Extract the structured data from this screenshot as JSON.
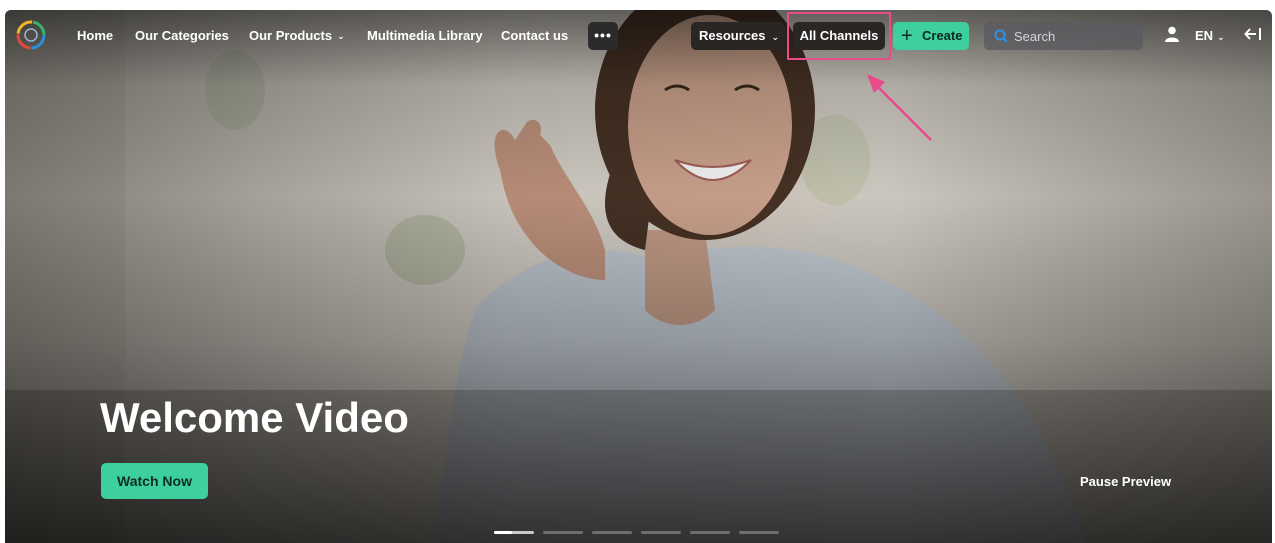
{
  "nav": {
    "links": [
      {
        "label": "Home"
      },
      {
        "label": "Our Categories"
      },
      {
        "label": "Our Products",
        "has_dropdown": true
      },
      {
        "label": "Multimedia Library"
      },
      {
        "label": "Contact us"
      }
    ],
    "more_label": "•••",
    "resources_label": "Resources",
    "all_channels_label": "All Channels",
    "create_label": "Create",
    "search_placeholder": "Search",
    "language": "EN"
  },
  "hero": {
    "title": "Welcome Video",
    "watch_button": "Watch Now",
    "pause_link": "Pause Preview",
    "slides_count": 6,
    "active_slide": 1,
    "active_slide_progress": 0.45
  },
  "icons": {
    "logo": "logo-icon",
    "more": "ellipsis-icon",
    "resources_chevron": "chevron-down-icon",
    "create": "plus-icon",
    "search": "search-icon",
    "user": "user-icon",
    "language_chevron": "chevron-down-icon",
    "exit": "exit-arrow-icon"
  },
  "colors": {
    "accent_green": "#3ecf9f",
    "highlight_pink": "#e84a8a",
    "dark_button": "#2a2624"
  }
}
